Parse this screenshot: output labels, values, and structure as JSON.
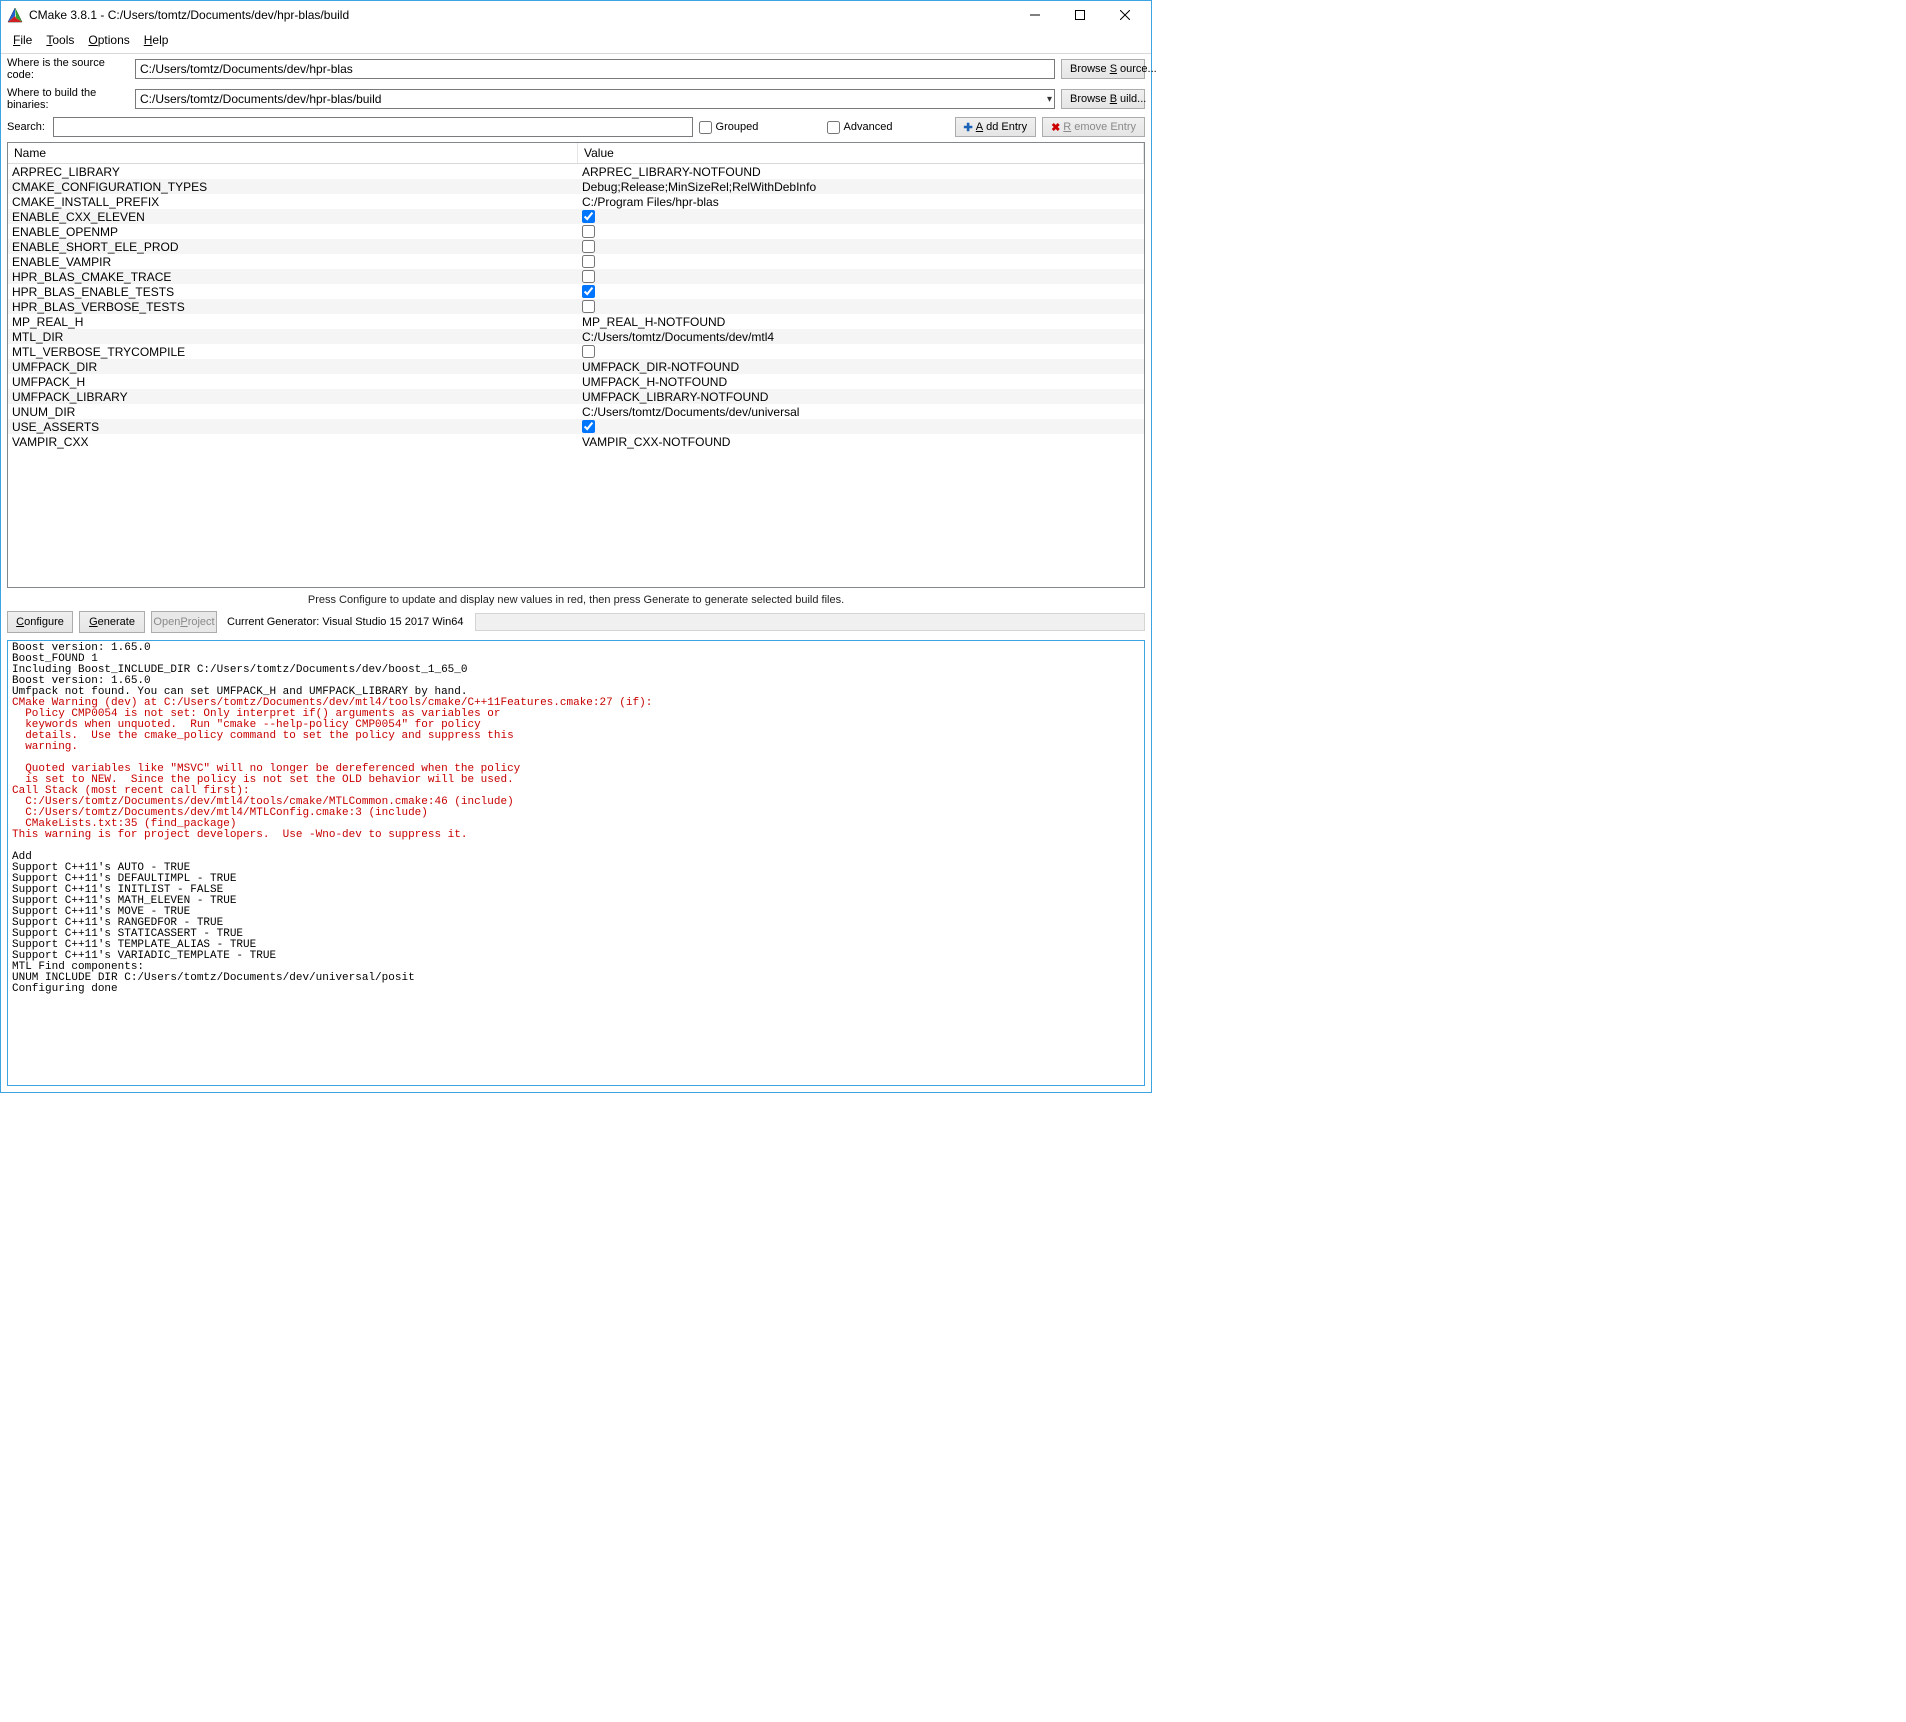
{
  "window": {
    "title": "CMake 3.8.1 - C:/Users/tomtz/Documents/dev/hpr-blas/build"
  },
  "menus": {
    "file": "File",
    "tools": "Tools",
    "options": "Options",
    "help": "Help"
  },
  "paths": {
    "source_label": "Where is the source code:",
    "source_value": "C:/Users/tomtz/Documents/dev/hpr-blas",
    "browse_source": "Browse Source...",
    "build_label": "Where to build the binaries:",
    "build_value": "C:/Users/tomtz/Documents/dev/hpr-blas/build",
    "browse_build": "Browse Build..."
  },
  "search": {
    "label": "Search:",
    "grouped": "Grouped",
    "advanced": "Advanced",
    "add_entry": "Add Entry",
    "remove_entry": "Remove Entry"
  },
  "columns": {
    "name": "Name",
    "value": "Value"
  },
  "rows": [
    {
      "name": "ARPREC_LIBRARY",
      "type": "text",
      "value": "ARPREC_LIBRARY-NOTFOUND"
    },
    {
      "name": "CMAKE_CONFIGURATION_TYPES",
      "type": "text",
      "value": "Debug;Release;MinSizeRel;RelWithDebInfo"
    },
    {
      "name": "CMAKE_INSTALL_PREFIX",
      "type": "text",
      "value": "C:/Program Files/hpr-blas"
    },
    {
      "name": "ENABLE_CXX_ELEVEN",
      "type": "bool",
      "value": true
    },
    {
      "name": "ENABLE_OPENMP",
      "type": "bool",
      "value": false
    },
    {
      "name": "ENABLE_SHORT_ELE_PROD",
      "type": "bool",
      "value": false
    },
    {
      "name": "ENABLE_VAMPIR",
      "type": "bool",
      "value": false
    },
    {
      "name": "HPR_BLAS_CMAKE_TRACE",
      "type": "bool",
      "value": false
    },
    {
      "name": "HPR_BLAS_ENABLE_TESTS",
      "type": "bool",
      "value": true
    },
    {
      "name": "HPR_BLAS_VERBOSE_TESTS",
      "type": "bool",
      "value": false
    },
    {
      "name": "MP_REAL_H",
      "type": "text",
      "value": "MP_REAL_H-NOTFOUND"
    },
    {
      "name": "MTL_DIR",
      "type": "text",
      "value": "C:/Users/tomtz/Documents/dev/mtl4"
    },
    {
      "name": "MTL_VERBOSE_TRYCOMPILE",
      "type": "bool",
      "value": false
    },
    {
      "name": "UMFPACK_DIR",
      "type": "text",
      "value": "UMFPACK_DIR-NOTFOUND"
    },
    {
      "name": "UMFPACK_H",
      "type": "text",
      "value": "UMFPACK_H-NOTFOUND"
    },
    {
      "name": "UMFPACK_LIBRARY",
      "type": "text",
      "value": "UMFPACK_LIBRARY-NOTFOUND"
    },
    {
      "name": "UNUM_DIR",
      "type": "text",
      "value": "C:/Users/tomtz/Documents/dev/universal"
    },
    {
      "name": "USE_ASSERTS",
      "type": "bool",
      "value": true
    },
    {
      "name": "VAMPIR_CXX",
      "type": "text",
      "value": "VAMPIR_CXX-NOTFOUND"
    }
  ],
  "hint": "Press Configure to update and display new values in red, then press Generate to generate selected build files.",
  "actions": {
    "configure": "Configure",
    "generate": "Generate",
    "open_project": "Open Project",
    "generator": "Current Generator: Visual Studio 15 2017 Win64"
  },
  "output": [
    {
      "t": "Boost version: 1.65.0",
      "c": "n"
    },
    {
      "t": "Boost_FOUND 1",
      "c": "n"
    },
    {
      "t": "Including Boost_INCLUDE_DIR C:/Users/tomtz/Documents/dev/boost_1_65_0",
      "c": "n"
    },
    {
      "t": "Boost version: 1.65.0",
      "c": "n"
    },
    {
      "t": "Umfpack not found. You can set UMFPACK_H and UMFPACK_LIBRARY by hand.",
      "c": "n"
    },
    {
      "t": "CMake Warning (dev) at C:/Users/tomtz/Documents/dev/mtl4/tools/cmake/C++11Features.cmake:27 (if):",
      "c": "w"
    },
    {
      "t": "  Policy CMP0054 is not set: Only interpret if() arguments as variables or",
      "c": "w"
    },
    {
      "t": "  keywords when unquoted.  Run \"cmake --help-policy CMP0054\" for policy",
      "c": "w"
    },
    {
      "t": "  details.  Use the cmake_policy command to set the policy and suppress this",
      "c": "w"
    },
    {
      "t": "  warning.",
      "c": "w"
    },
    {
      "t": "",
      "c": "w"
    },
    {
      "t": "  Quoted variables like \"MSVC\" will no longer be dereferenced when the policy",
      "c": "w"
    },
    {
      "t": "  is set to NEW.  Since the policy is not set the OLD behavior will be used.",
      "c": "w"
    },
    {
      "t": "Call Stack (most recent call first):",
      "c": "w"
    },
    {
      "t": "  C:/Users/tomtz/Documents/dev/mtl4/tools/cmake/MTLCommon.cmake:46 (include)",
      "c": "w"
    },
    {
      "t": "  C:/Users/tomtz/Documents/dev/mtl4/MTLConfig.cmake:3 (include)",
      "c": "w"
    },
    {
      "t": "  CMakeLists.txt:35 (find_package)",
      "c": "w"
    },
    {
      "t": "This warning is for project developers.  Use -Wno-dev to suppress it.",
      "c": "w"
    },
    {
      "t": "",
      "c": "n"
    },
    {
      "t": "Add",
      "c": "n"
    },
    {
      "t": "Support C++11's AUTO - TRUE",
      "c": "n"
    },
    {
      "t": "Support C++11's DEFAULTIMPL - TRUE",
      "c": "n"
    },
    {
      "t": "Support C++11's INITLIST - FALSE",
      "c": "n"
    },
    {
      "t": "Support C++11's MATH_ELEVEN - TRUE",
      "c": "n"
    },
    {
      "t": "Support C++11's MOVE - TRUE",
      "c": "n"
    },
    {
      "t": "Support C++11's RANGEDFOR - TRUE",
      "c": "n"
    },
    {
      "t": "Support C++11's STATICASSERT - TRUE",
      "c": "n"
    },
    {
      "t": "Support C++11's TEMPLATE_ALIAS - TRUE",
      "c": "n"
    },
    {
      "t": "Support C++11's VARIADIC_TEMPLATE - TRUE",
      "c": "n"
    },
    {
      "t": "MTL Find components:",
      "c": "n"
    },
    {
      "t": "UNUM INCLUDE DIR C:/Users/tomtz/Documents/dev/universal/posit",
      "c": "n"
    },
    {
      "t": "Configuring done",
      "c": "n"
    }
  ]
}
